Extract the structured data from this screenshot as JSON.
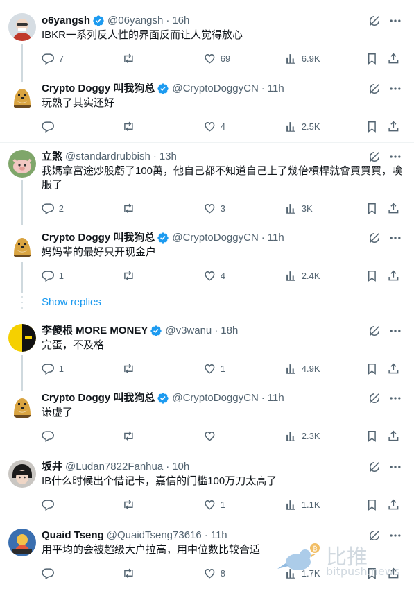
{
  "tweets": [
    {
      "name": "o6yangsh",
      "verified": true,
      "handle": "@06yangsh",
      "time": "16h",
      "text": "IBKR一系列反人性的界面反而让人觉得放心",
      "replies": "7",
      "retweets": "",
      "likes": "69",
      "views": "6.9K"
    },
    {
      "name": "Crypto Doggy 叫我狗总",
      "verified": true,
      "handle": "@CryptoDoggyCN",
      "time": "11h",
      "text": "玩熟了其实还好",
      "replies": "",
      "retweets": "",
      "likes": "4",
      "views": "2.5K"
    },
    {
      "name": "立煞",
      "verified": false,
      "handle": "@standardrubbish",
      "time": "13h",
      "text": "我媽拿富途炒股虧了100萬，他自己都不知道自己上了幾倍槓桿就會買買買，唉服了",
      "replies": "2",
      "retweets": "",
      "likes": "3",
      "views": "3K"
    },
    {
      "name": "Crypto Doggy 叫我狗总",
      "verified": true,
      "handle": "@CryptoDoggyCN",
      "time": "11h",
      "text": "妈妈辈的最好只开现金户",
      "replies": "1",
      "retweets": "",
      "likes": "4",
      "views": "2.4K"
    },
    {
      "name": "李傻根 MORE MONEY",
      "verified": true,
      "handle": "@v3wanu",
      "time": "18h",
      "text": "完蛋，不及格",
      "replies": "1",
      "retweets": "",
      "likes": "1",
      "views": "4.9K"
    },
    {
      "name": "Crypto Doggy 叫我狗总",
      "verified": true,
      "handle": "@CryptoDoggyCN",
      "time": "11h",
      "text": "谦虚了",
      "replies": "",
      "retweets": "",
      "likes": "",
      "views": "2.3K"
    },
    {
      "name": "坂井",
      "verified": false,
      "handle": "@Ludan7822Fanhua",
      "time": "10h",
      "text": "IB什么时候出个借记卡，嘉信的门槛100万刀太高了",
      "replies": "",
      "retweets": "",
      "likes": "1",
      "views": "1.1K"
    },
    {
      "name": "Quaid Tseng",
      "verified": false,
      "handle": "@QuaidTseng73616",
      "time": "11h",
      "text": "用平均的会被超级大户拉高，用中位数比较合适",
      "replies": "",
      "retweets": "",
      "likes": "8",
      "views": "1.7K"
    }
  ],
  "show_replies": "Show replies",
  "watermark": {
    "cn": "比推",
    "en": "bitpush.news"
  },
  "colors": {
    "accent": "#1d9bf0",
    "secondary_text": "#536471",
    "divider": "#eff3f4",
    "thread_line": "#cfd9de"
  },
  "icons": [
    "verified-badge-icon",
    "grok-icon",
    "more-icon",
    "reply-icon",
    "retweet-icon",
    "like-icon",
    "views-icon",
    "bookmark-icon",
    "share-icon"
  ]
}
